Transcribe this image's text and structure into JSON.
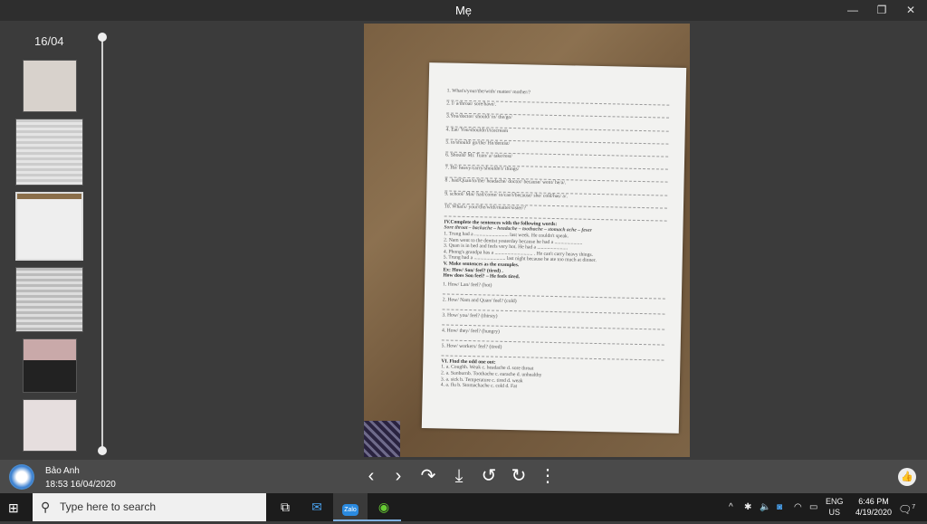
{
  "window": {
    "title": "Mẹ",
    "minimize": "—",
    "maximize": "❐",
    "close": "✕"
  },
  "timeline": {
    "date": "16/04"
  },
  "paper": {
    "items": [
      "1. What's/your/the/with/ matter/ mother/?",
      "2. I/ a/throat/ sore/have/.",
      "3.You/doctor/ should/ to/ the/go/",
      "4. Eat/ You/shouldn't/icecream",
      "5. to/should/ go/the/ He/dentist/",
      "6. Should/ Mr. Tuan/ a/ take/rest/",
      "7. He/ heavy/carry/shouldn't/ things/",
      "8 . had/Quan/to/the/ headache/ doctor/ because/ went/ he/a/.",
      "9. school/ Mai/ had/come/ to/can't/because/ she/ cold/has/ a/.",
      "10. What's/ your/the/with/matter/sister/?"
    ],
    "sec4_title": "IV.Complete the sentences with the following words:",
    "sec4_words": "Sore throat – backache – headache – toothache – stomach ache – fever",
    "sec4_items": [
      "1. Trung had a ........................... last week. He couldn't speak.",
      "2. Nam went to the dentist yesterday because he had a ......................",
      "3. Quan is in bed and feels very hot. He had a ........................",
      "4. Phong's grandpa has a .............................. . He can't carry heavy things.",
      "5. Trung had a ......................... last night because he ate too much at dinner."
    ],
    "sec5_title": "V. Make sentences as the examples.",
    "sec5_ex1": "Ex: How/ Son/ feel? (tired) .",
    "sec5_ex2": "How does Son feel? – He feels tired.",
    "sec5_items": [
      "1. How/ Lan/ feel? (hot)",
      "2. How/ Nam and Quan/ feel? (cold)",
      "3. How/ you/ feel? (thirsty)",
      "4. How/ they/ feel? (hungry)",
      "5. How/ workers/ feel? (tired)"
    ],
    "sec6_title": "VI. Find the odd one out:",
    "sec6_items": [
      "1. a. Coughh. Weak c. headache d. sore throat",
      "2. a. Sunburnb. Toothache c. earache d. unhealthy",
      "3. a. sick b. Temperature c. tired d. weak",
      "4. a. flu b. Stomachache c. cold d. Fat"
    ]
  },
  "sender": {
    "name": "Bảo Anh",
    "time": "18:53 16/04/2020"
  },
  "toolbar": {
    "prev": "‹",
    "next": "›",
    "share": "↷",
    "download": "⤓",
    "rotate_left": "↺",
    "rotate_right": "↻",
    "more": "⋮",
    "like": "👍"
  },
  "taskbar": {
    "search_placeholder": "Type here to search",
    "lang1": "ENG",
    "lang2": "US",
    "time": "6:46 PM",
    "date": "4/19/2020",
    "notif_count": "7",
    "zalo": "Zalo"
  }
}
